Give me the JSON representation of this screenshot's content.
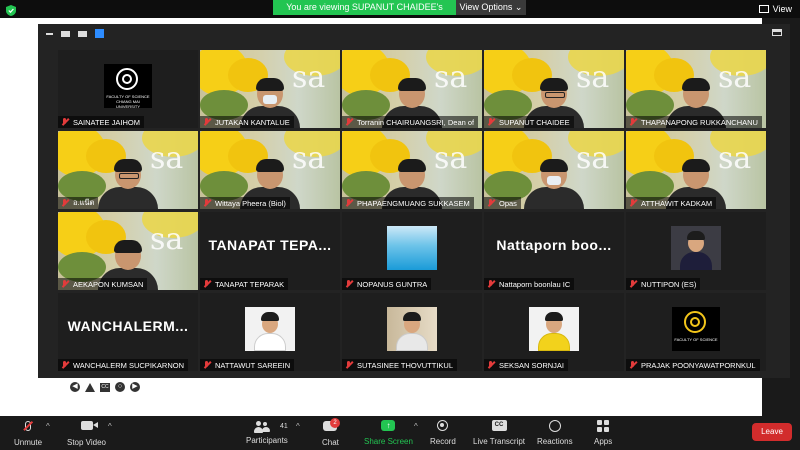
{
  "banner": {
    "share_text": "You are viewing SUPANUT CHAIDEE's screen",
    "view_options": "View Options",
    "view_options_caret": "⌄"
  },
  "top_right": {
    "view_label": "View"
  },
  "nav_strip": {
    "cc": "CC"
  },
  "participants": [
    {
      "name": "SAINATEE JAIHOM",
      "kind": "logo",
      "logo_text": "FACULTY OF SCIENCE CHIANG MAI UNIVERSITY"
    },
    {
      "name": "JUTAKAN KANTALUE",
      "kind": "video"
    },
    {
      "name": "Torranin CHAIRUANGSRI, Dean of",
      "kind": "video"
    },
    {
      "name": "SUPANUT CHAIDEE",
      "kind": "video"
    },
    {
      "name": "THAPANAPONG RUKKANCHANU",
      "kind": "video"
    },
    {
      "name": "อ.แน๊ต",
      "kind": "video"
    },
    {
      "name": "Wittaya Pheera (Biol)",
      "kind": "video"
    },
    {
      "name": "PHAPAENGMUANG SUKKASEM",
      "kind": "video"
    },
    {
      "name": "Opas",
      "kind": "video"
    },
    {
      "name": "ATTHAWIT KADKAM",
      "kind": "video"
    },
    {
      "name": "AEKAPON KUMSAN",
      "kind": "video"
    },
    {
      "name": "TANAPAT TEPARAK",
      "kind": "text",
      "big": "TANAPAT  TEPA..."
    },
    {
      "name": "NOPANUS GUNTRA",
      "kind": "photo-sky"
    },
    {
      "name": "Nattaporn boonlau IC",
      "kind": "text",
      "big": "Nattaporn  boo..."
    },
    {
      "name": "NUTTIPON (ES)",
      "kind": "photo-dark"
    },
    {
      "name": "WANCHALERM SUCPIKARNON",
      "kind": "text",
      "big": "WANCHALERM..."
    },
    {
      "name": "NATTAWUT SAREEIN",
      "kind": "photo-white"
    },
    {
      "name": "SUTASINEE THOVUTTIKUL",
      "kind": "photo-office"
    },
    {
      "name": "SEKSAN SORNJAI",
      "kind": "photo-yellow"
    },
    {
      "name": "PRAJAK POONYAWATPORNKUL",
      "kind": "logo-yellow",
      "logo_text": "FACULTY OF SCIENCE"
    }
  ],
  "toolbar": {
    "unmute": "Unmute",
    "stop_video": "Stop Video",
    "participants": "Participants",
    "participants_count": "41",
    "chat": "Chat",
    "chat_badge": "2",
    "share_screen": "Share Screen",
    "record": "Record",
    "live_transcript": "Live Transcript",
    "reactions": "Reactions",
    "apps": "Apps",
    "leave": "Leave",
    "caret": "^"
  },
  "colors": {
    "accent_green": "#23c552",
    "leave_red": "#d22c2c",
    "mic_red": "#e23b3b",
    "active_blue": "#2d8cff"
  }
}
